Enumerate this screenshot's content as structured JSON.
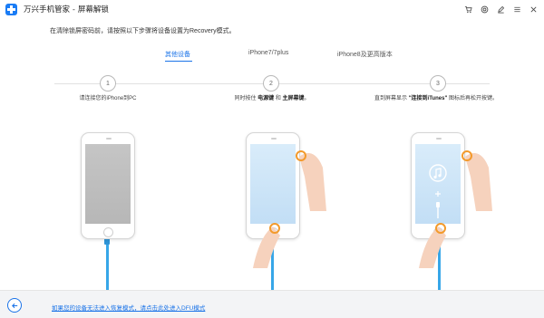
{
  "titlebar": {
    "app_name": "万兴手机管家",
    "separator": "-",
    "module_name": "屏幕解锁",
    "icons": [
      "cart-icon",
      "support-icon",
      "edit-icon",
      "menu-icon",
      "close-icon"
    ]
  },
  "instruction": "在清除锁屏密码前，请按照以下步骤将设备设置为Recovery模式。",
  "tabs": [
    {
      "label": "其他设备",
      "active": true
    },
    {
      "label": "iPhone7/7plus",
      "active": false
    },
    {
      "label": "iPhone8及更高版本",
      "active": false
    }
  ],
  "steps": [
    {
      "number": "1",
      "text": "请连接您的iPhone到PC"
    },
    {
      "number": "2",
      "prefix": "同时按住",
      "key1": "电源键",
      "middle": "和",
      "key2": "主屏幕键",
      "suffix": "。"
    },
    {
      "number": "3",
      "prefix": "直到屏幕显示",
      "key1": "\"连接到iTunes\"",
      "suffix": "图标后再松开按键。"
    }
  ],
  "footer": {
    "back_icon": "arrow-left-icon",
    "dfu_link": "如果您的设备无法进入恢复模式，请点击此处进入DFU模式"
  },
  "colors": {
    "accent": "#1a73e8",
    "cable": "#37a6e8",
    "finger_ring": "#f39a2b"
  }
}
